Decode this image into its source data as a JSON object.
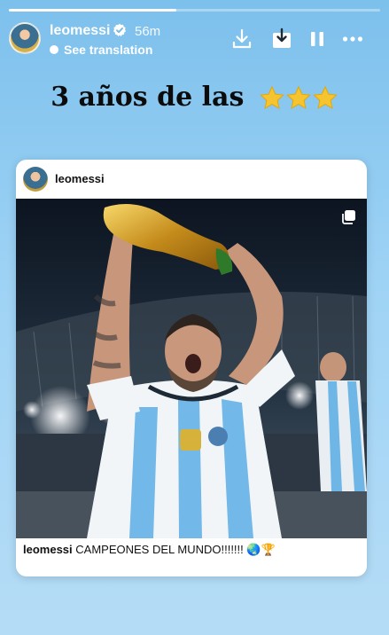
{
  "story": {
    "progress": 0.45,
    "username": "leomessi",
    "time": "56m",
    "see_translation": "See translation",
    "headline": "3 años de las",
    "headline_emoji": "⭐⭐⭐"
  },
  "post": {
    "username": "leomessi",
    "caption_user": "leomessi",
    "caption_text": "CAMPEONES DEL MUNDO!!!!!!!",
    "caption_emoji": "🌏🏆"
  },
  "colors": {
    "background": "#9fd3f5",
    "verified": "#ffffff",
    "star": "#f6c431"
  },
  "icons": [
    "verified-icon",
    "download-icon",
    "save-to-collection-icon",
    "pause-icon",
    "more-icon",
    "translate-icon",
    "multi-photo-icon"
  ]
}
